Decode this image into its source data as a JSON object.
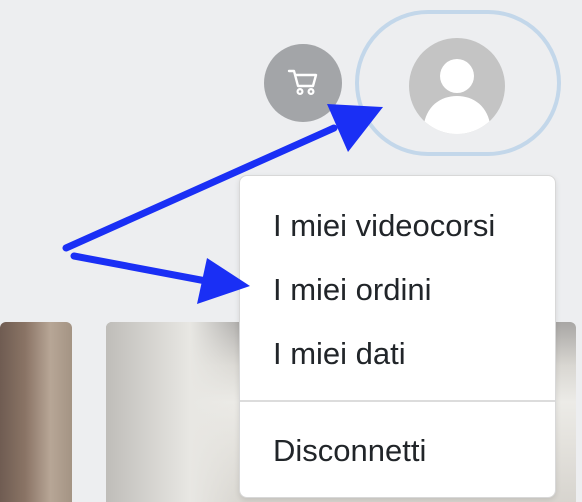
{
  "header": {
    "cart_icon": "shopping-cart-icon",
    "avatar_icon": "user-avatar-icon"
  },
  "user_menu": {
    "items": [
      {
        "label": "I miei videocorsi"
      },
      {
        "label": "I miei ordini"
      },
      {
        "label": "I miei dati"
      }
    ],
    "logout_label": "Disconnetti"
  },
  "colors": {
    "background": "#edeef0",
    "cart_button": "#a3a5a8",
    "avatar": "#c4c4c4",
    "focus_ring": "#c3d7ea",
    "arrow": "#1a2ff5",
    "menu_text": "#212529"
  }
}
